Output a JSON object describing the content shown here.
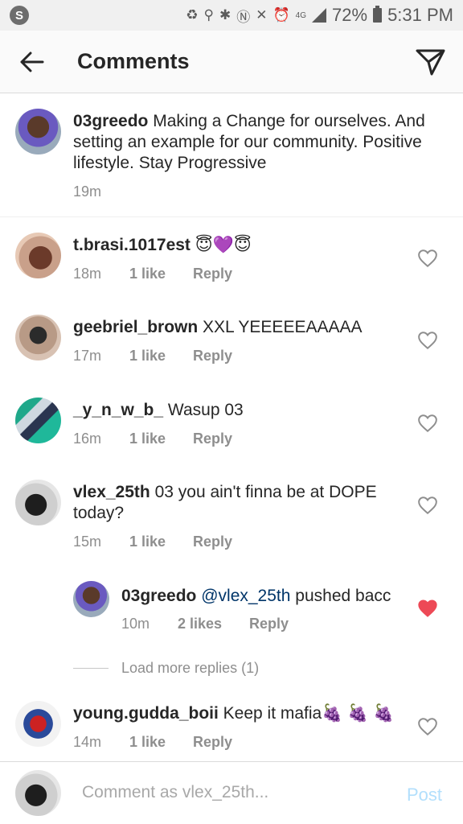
{
  "status_bar": {
    "left_icon_letter": "S",
    "battery_percent": "72%",
    "time": "5:31 PM",
    "network": "4G"
  },
  "header": {
    "title": "Comments"
  },
  "caption": {
    "username": "03greedo",
    "text": "Making a Change for ourselves. And setting an example for our community. Positive lifestyle. Stay Progressive",
    "time": "19m"
  },
  "comments": [
    {
      "username": "t.brasi.1017est",
      "text": "😇💜😇",
      "time": "18m",
      "likes": "1 like",
      "reply": "Reply",
      "liked": false
    },
    {
      "username": "geebriel_brown",
      "text": "XXL YEEEEEAAAAA",
      "time": "17m",
      "likes": "1 like",
      "reply": "Reply",
      "liked": false
    },
    {
      "username": "_y_n_w_b_",
      "text": "Wasup 03",
      "time": "16m",
      "likes": "1 like",
      "reply": "Reply",
      "liked": false
    },
    {
      "username": "vlex_25th",
      "text": "03 you ain't finna be at DOPE today?",
      "time": "15m",
      "likes": "1 like",
      "reply": "Reply",
      "liked": false
    }
  ],
  "reply": {
    "username": "03greedo",
    "mention": "@vlex_25th",
    "text": "pushed bacc",
    "time": "10m",
    "likes": "2 likes",
    "reply": "Reply",
    "liked": true
  },
  "load_more": "Load more replies (1)",
  "last_comment": {
    "username": "young.gudda_boii",
    "text": "Keep it mafia🍇 🍇 🍇",
    "time": "14m",
    "likes": "1 like",
    "reply": "Reply",
    "liked": false
  },
  "composer": {
    "placeholder": "Comment as vlex_25th...",
    "post_label": "Post"
  },
  "colors": {
    "heart_liked": "#ed4956",
    "mention": "#003569",
    "post_disabled": "#b2dffc"
  }
}
